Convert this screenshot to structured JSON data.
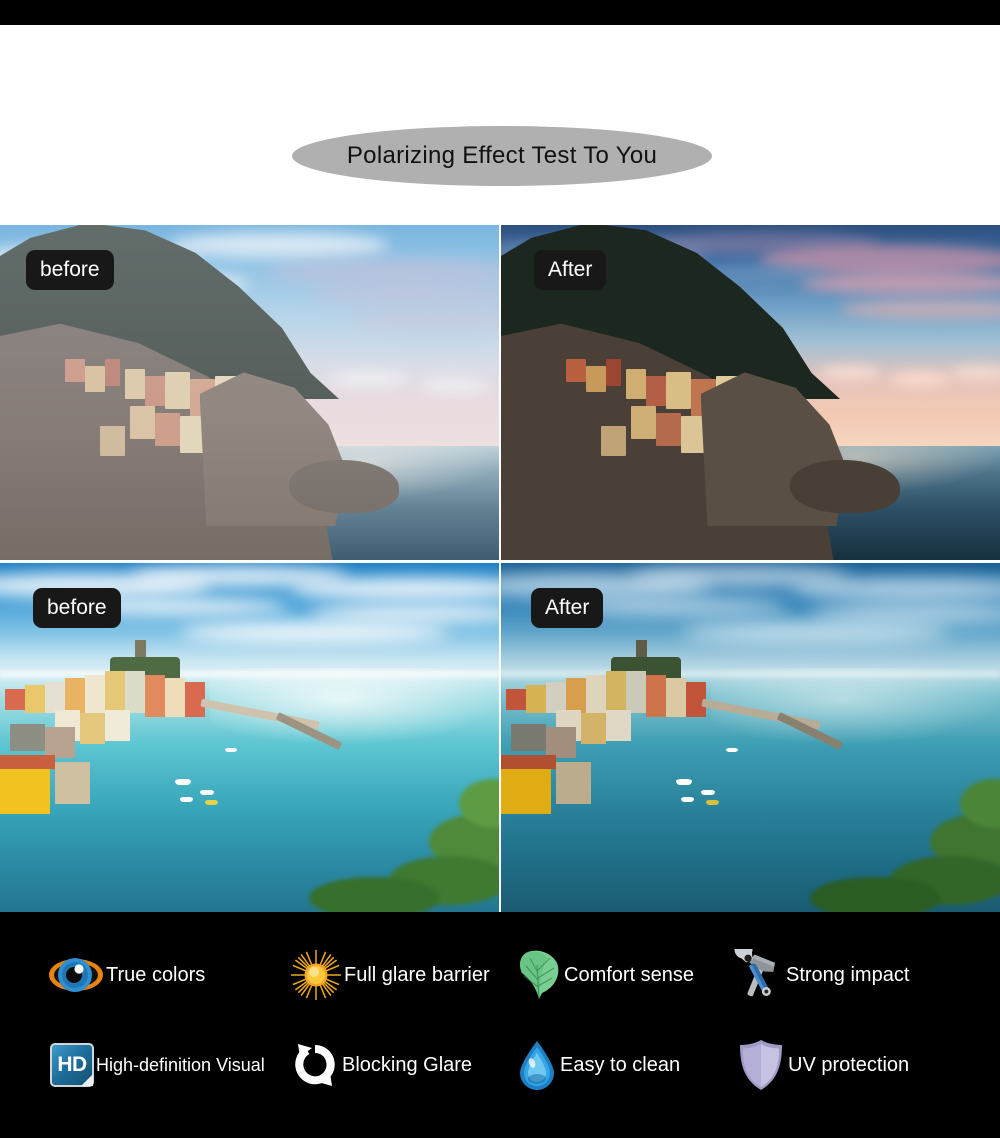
{
  "title": {
    "text": "Polarizing Effect Test To You",
    "pill_color": "#b0b0b0"
  },
  "comparison": {
    "label_before": "before",
    "label_after": "After",
    "cells": [
      {
        "position": "top-left",
        "label": "before",
        "scene": "Manarola cliffside village at dusk, washed-out hazy sky"
      },
      {
        "position": "top-right",
        "label": "After",
        "scene": "Manarola cliffside village at dusk, saturated pink sunset sky"
      },
      {
        "position": "bottom-left",
        "label": "before",
        "scene": "Vernazza harbour bay, bright washed-out turquoise water"
      },
      {
        "position": "bottom-right",
        "label": "After",
        "scene": "Vernazza harbour bay, deeper contrast blue water"
      }
    ]
  },
  "features": {
    "row1": [
      {
        "icon": "eye-icon",
        "label": "True colors"
      },
      {
        "icon": "sun-icon",
        "label": "Full glare barrier"
      },
      {
        "icon": "leaf-icon",
        "label": "Comfort sense"
      },
      {
        "icon": "tools-icon",
        "label": "Strong impact"
      }
    ],
    "row2": [
      {
        "icon": "hd-icon",
        "label": "High-definition Visual",
        "badge_text": "HD"
      },
      {
        "icon": "refresh-icon",
        "label": "Blocking Glare"
      },
      {
        "icon": "water-drop-icon",
        "label": "Easy to clean"
      },
      {
        "icon": "shield-icon",
        "label": "UV protection"
      }
    ]
  },
  "colors": {
    "background": "#000000",
    "panel_text": "#ffffff",
    "title_pill": "#b0b0b0",
    "badge_background": "#181818",
    "hd_blue": "#1f6f9e",
    "drop_blue": "#2a9fe0",
    "shield_purple": "#b7b3d8",
    "leaf_green": "#7fcf96",
    "sun_orange": "#f5a623"
  }
}
